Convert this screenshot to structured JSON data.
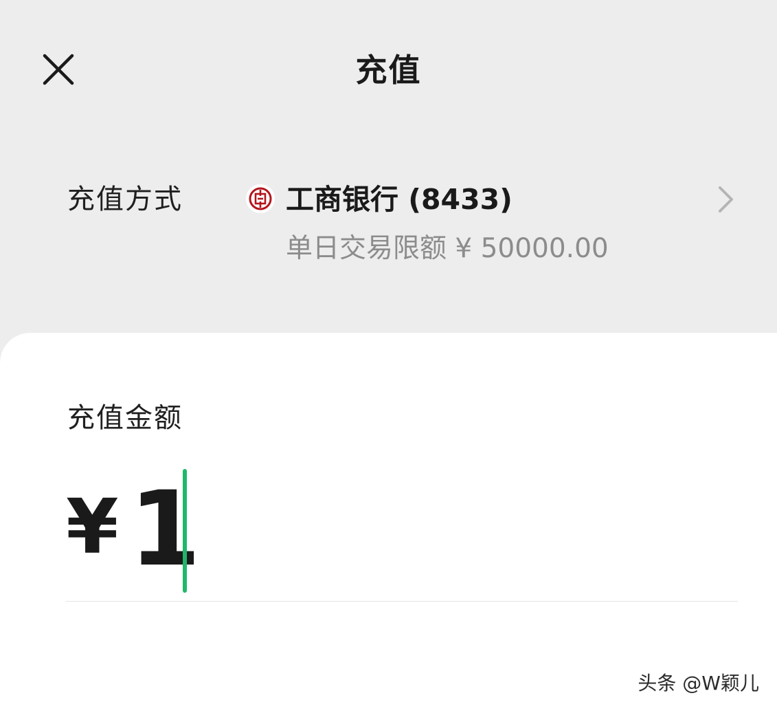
{
  "header": {
    "close_icon": "close-icon",
    "title": "充值"
  },
  "payment_method": {
    "label": "充值方式",
    "bank_icon": "icbc-bank-logo-icon",
    "bank_name": "工商银行 (8433)",
    "daily_limit": "单日交易限额 ¥ 50000.00",
    "chevron_icon": "chevron-right-icon"
  },
  "amount": {
    "label": "充值金额",
    "currency_symbol": "¥",
    "value": "1"
  },
  "watermark": "头条 @W颖儿",
  "colors": {
    "background": "#ededed",
    "card": "#ffffff",
    "caret": "#1fb86a",
    "secondary_text": "#8c8c8c",
    "bank_logo_red": "#b3151b"
  }
}
